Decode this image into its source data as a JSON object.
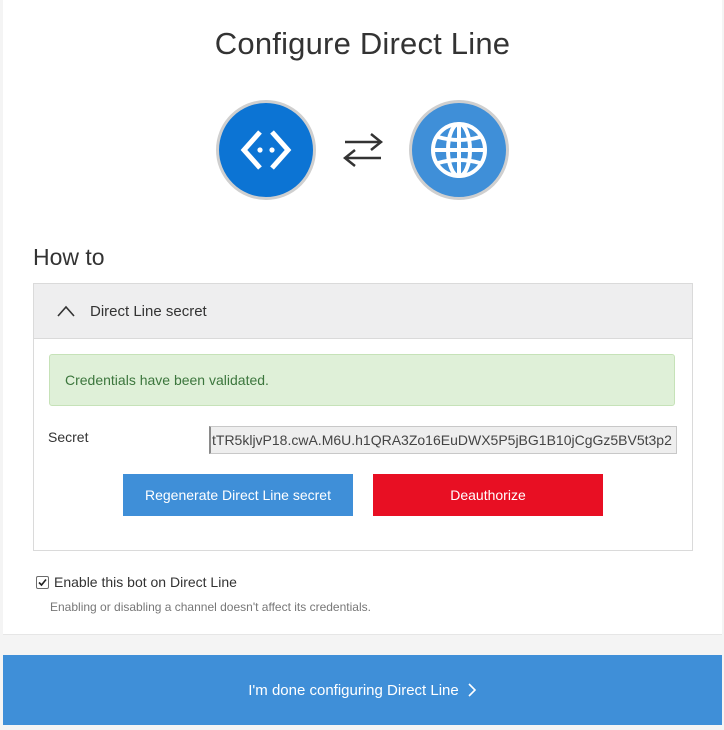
{
  "page": {
    "title": "Configure Direct Line"
  },
  "icons": {
    "bot": "direct-line-code-icon",
    "exchange": "exchange-arrows-icon",
    "web": "globe-icon"
  },
  "how_to": {
    "heading": "How to"
  },
  "panel": {
    "header_label": "Direct Line secret",
    "expanded": true,
    "alert_text": "Credentials have been validated.",
    "secret_label": "Secret",
    "secret_value": "tTR5kljvP18.cwA.M6U.h1QRA3Zo16EuDWX5P5jBG1B10jCgGz5BV5t3p2",
    "regenerate_label": "Regenerate Direct Line secret",
    "deauthorize_label": "Deauthorize"
  },
  "enable": {
    "label": "Enable this bot on Direct Line",
    "checked": true,
    "hint": "Enabling or disabling a channel doesn't affect its credentials."
  },
  "footer": {
    "done_label": "I'm done configuring Direct Line"
  },
  "colors": {
    "accent_blue": "#3f8fd8",
    "bot_blue": "#0c74d4",
    "danger_red": "#e80f23",
    "success_bg": "#dff0d8",
    "success_text": "#3c763d"
  }
}
